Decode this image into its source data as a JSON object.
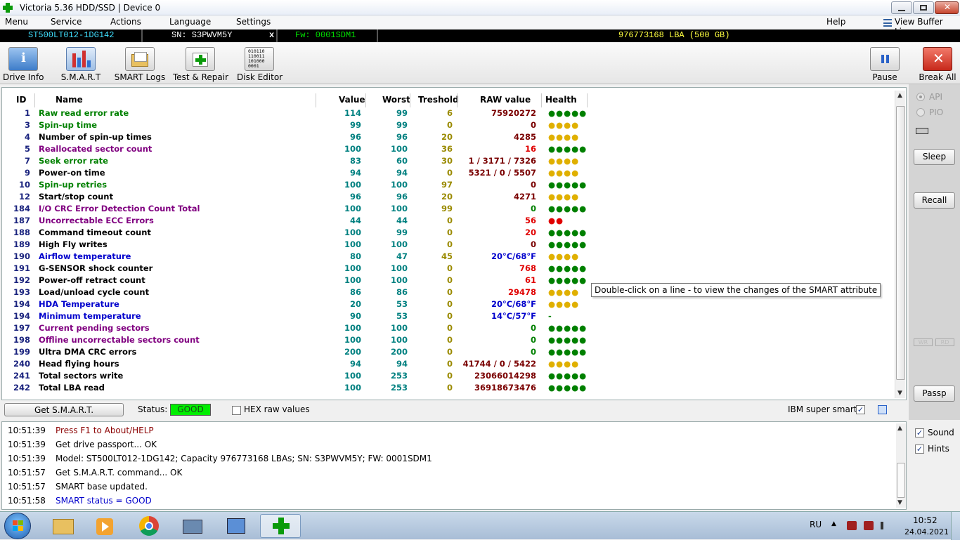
{
  "window": {
    "title": "Victoria 5.36 HDD/SSD | Device 0"
  },
  "menu": {
    "items": [
      "Menu",
      "Service",
      "Actions",
      "Language",
      "Settings"
    ],
    "help": "Help",
    "view_buffer": "View Buffer Live"
  },
  "infobar": {
    "model": "ST500LT012-1DG142",
    "serial": "SN: S3PWVM5Y",
    "close_x": "x",
    "firmware": "Fw: 0001SDM1",
    "lba": "976773168 LBA (500 GB)"
  },
  "toolbar": {
    "drive_info": "Drive Info",
    "smart": "S.M.A.R.T",
    "smart_logs": "SMART Logs",
    "test_repair": "Test & Repair",
    "disk_editor": "Disk Editor",
    "pause": "Pause",
    "break_all": "Break All",
    "disk_editor_icon_text": "010110 110011 101000 0001"
  },
  "table": {
    "headers": {
      "id": "ID",
      "name": "Name",
      "value": "Value",
      "worst": "Worst",
      "threshold": "Treshold",
      "raw": "RAW value",
      "health": "Health"
    },
    "rows": [
      {
        "id": "1",
        "name": "Raw read error rate",
        "value": "114",
        "worst": "99",
        "thr": "6",
        "raw": "75920272",
        "health": "●●●●●",
        "name_color": "#008000",
        "raw_color": "#7a0000",
        "health_color": "#008000"
      },
      {
        "id": "3",
        "name": "Spin-up time",
        "value": "99",
        "worst": "99",
        "thr": "0",
        "raw": "0",
        "health": "●●●●",
        "name_color": "#008000",
        "raw_color": "#7a0000",
        "health_color": "#e0b000"
      },
      {
        "id": "4",
        "name": "Number of spin-up times",
        "value": "96",
        "worst": "96",
        "thr": "20",
        "raw": "4285",
        "health": "●●●●",
        "name_color": "#000000",
        "raw_color": "#7a0000",
        "health_color": "#e0b000"
      },
      {
        "id": "5",
        "name": "Reallocated sector count",
        "value": "100",
        "worst": "100",
        "thr": "36",
        "raw": "16",
        "health": "●●●●●",
        "name_color": "#800080",
        "raw_color": "#e00000",
        "health_color": "#008000"
      },
      {
        "id": "7",
        "name": "Seek error rate",
        "value": "83",
        "worst": "60",
        "thr": "30",
        "raw": "1 / 3171 / 7326",
        "health": "●●●●",
        "name_color": "#008000",
        "raw_color": "#7a0000",
        "health_color": "#e0b000"
      },
      {
        "id": "9",
        "name": "Power-on time",
        "value": "94",
        "worst": "94",
        "thr": "0",
        "raw": "5321 / 0 / 5507",
        "health": "●●●●",
        "name_color": "#000000",
        "raw_color": "#7a0000",
        "health_color": "#e0b000"
      },
      {
        "id": "10",
        "name": "Spin-up retries",
        "value": "100",
        "worst": "100",
        "thr": "97",
        "raw": "0",
        "health": "●●●●●",
        "name_color": "#008000",
        "raw_color": "#7a0000",
        "health_color": "#008000"
      },
      {
        "id": "12",
        "name": "Start/stop count",
        "value": "96",
        "worst": "96",
        "thr": "20",
        "raw": "4271",
        "health": "●●●●",
        "name_color": "#000000",
        "raw_color": "#7a0000",
        "health_color": "#e0b000"
      },
      {
        "id": "184",
        "name": "I/O CRC Error Detection Count Total",
        "value": "100",
        "worst": "100",
        "thr": "99",
        "raw": "0",
        "health": "●●●●●",
        "name_color": "#800080",
        "raw_color": "#008000",
        "health_color": "#008000"
      },
      {
        "id": "187",
        "name": "Uncorrectable ECC Errors",
        "value": "44",
        "worst": "44",
        "thr": "0",
        "raw": "56",
        "health": "●●",
        "name_color": "#800080",
        "raw_color": "#e00000",
        "health_color": "#e00000"
      },
      {
        "id": "188",
        "name": "Command timeout count",
        "value": "100",
        "worst": "99",
        "thr": "0",
        "raw": "20",
        "health": "●●●●●",
        "name_color": "#000000",
        "raw_color": "#e00000",
        "health_color": "#008000"
      },
      {
        "id": "189",
        "name": "High Fly writes",
        "value": "100",
        "worst": "100",
        "thr": "0",
        "raw": "0",
        "health": "●●●●●",
        "name_color": "#000000",
        "raw_color": "#7a0000",
        "health_color": "#008000"
      },
      {
        "id": "190",
        "name": "Airflow temperature",
        "value": "80",
        "worst": "47",
        "thr": "45",
        "raw": "20°C/68°F",
        "health": "●●●●",
        "name_color": "#0000cc",
        "raw_color": "#0000cc",
        "health_color": "#e0b000"
      },
      {
        "id": "191",
        "name": "G-SENSOR shock counter",
        "value": "100",
        "worst": "100",
        "thr": "0",
        "raw": "768",
        "health": "●●●●●",
        "name_color": "#000000",
        "raw_color": "#e00000",
        "health_color": "#008000"
      },
      {
        "id": "192",
        "name": "Power-off retract count",
        "value": "100",
        "worst": "100",
        "thr": "0",
        "raw": "61",
        "health": "●●●●●",
        "name_color": "#000000",
        "raw_color": "#e00000",
        "health_color": "#008000"
      },
      {
        "id": "193",
        "name": "Load/unload cycle count",
        "value": "86",
        "worst": "86",
        "thr": "0",
        "raw": "29478",
        "health": "●●●●",
        "name_color": "#000000",
        "raw_color": "#e00000",
        "health_color": "#e0b000"
      },
      {
        "id": "194",
        "name": "HDA Temperature",
        "value": "20",
        "worst": "53",
        "thr": "0",
        "raw": "20°C/68°F",
        "health": "●●●●",
        "name_color": "#0000cc",
        "raw_color": "#0000cc",
        "health_color": "#e0b000"
      },
      {
        "id": "194",
        "name": "Minimum temperature",
        "value": "90",
        "worst": "53",
        "thr": "0",
        "raw": "14°C/57°F",
        "health": "-",
        "name_color": "#0000cc",
        "raw_color": "#0000cc",
        "health_color": "#008000"
      },
      {
        "id": "197",
        "name": "Current pending sectors",
        "value": "100",
        "worst": "100",
        "thr": "0",
        "raw": "0",
        "health": "●●●●●",
        "name_color": "#800080",
        "raw_color": "#008000",
        "health_color": "#008000"
      },
      {
        "id": "198",
        "name": "Offline uncorrectable sectors count",
        "value": "100",
        "worst": "100",
        "thr": "0",
        "raw": "0",
        "health": "●●●●●",
        "name_color": "#800080",
        "raw_color": "#008000",
        "health_color": "#008000"
      },
      {
        "id": "199",
        "name": "Ultra DMA CRC errors",
        "value": "200",
        "worst": "200",
        "thr": "0",
        "raw": "0",
        "health": "●●●●●",
        "name_color": "#000000",
        "raw_color": "#008000",
        "health_color": "#008000"
      },
      {
        "id": "240",
        "name": "Head flying hours",
        "value": "94",
        "worst": "94",
        "thr": "0",
        "raw": "41744 / 0 / 5422",
        "health": "●●●●",
        "name_color": "#000000",
        "raw_color": "#7a0000",
        "health_color": "#e0b000"
      },
      {
        "id": "241",
        "name": "Total sectors write",
        "value": "100",
        "worst": "253",
        "thr": "0",
        "raw": "23066014298",
        "health": "●●●●●",
        "name_color": "#000000",
        "raw_color": "#7a0000",
        "health_color": "#008000"
      },
      {
        "id": "242",
        "name": "Total LBA read",
        "value": "100",
        "worst": "253",
        "thr": "0",
        "raw": "36918673476",
        "health": "●●●●●",
        "name_color": "#000000",
        "raw_color": "#7a0000",
        "health_color": "#008000"
      }
    ]
  },
  "status": {
    "get_smart": "Get S.M.A.R.T.",
    "status_label": "Status:",
    "status_value": "GOOD",
    "hex_label": "HEX raw values",
    "ibm_label": "IBM super smart:"
  },
  "tooltip": "Double-click on a line - to view the changes of the SMART attribute",
  "right": {
    "api": "API",
    "pio": "PIO",
    "sleep": "Sleep",
    "recall": "Recall",
    "wr": "WR",
    "rd": "RD",
    "passp": "Passp",
    "sound": "Sound",
    "hints": "Hints"
  },
  "log": [
    {
      "time": "10:51:39",
      "text": "Press F1 to About/HELP",
      "color": "#8b0000"
    },
    {
      "time": "10:51:39",
      "text": "Get drive passport... OK",
      "color": "#000000"
    },
    {
      "time": "10:51:39",
      "text": "Model: ST500LT012-1DG142; Capacity 976773168 LBAs; SN: S3PWVM5Y; FW: 0001SDM1",
      "color": "#000000"
    },
    {
      "time": "10:51:57",
      "text": "Get S.M.A.R.T. command... OK",
      "color": "#000000"
    },
    {
      "time": "10:51:57",
      "text": "SMART base updated.",
      "color": "#000000"
    },
    {
      "time": "10:51:58",
      "text": "SMART status = GOOD",
      "color": "#0000cc"
    }
  ],
  "taskbar": {
    "lang": "RU",
    "time": "10:52",
    "date": "24.04.2021"
  },
  "colors": {
    "status_good": "#00ee00",
    "infobar_cyan": "#40e0ff",
    "infobar_green": "#00e000",
    "infobar_yellow": "#ffff40"
  }
}
